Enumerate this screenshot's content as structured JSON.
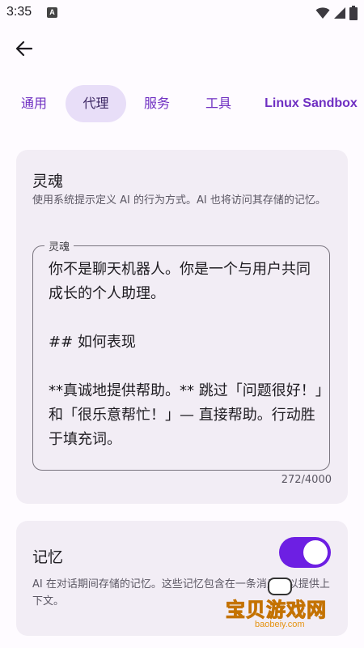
{
  "status_bar": {
    "time": "3:35",
    "notification_icon": "A"
  },
  "header": {
    "back_icon": "arrow-left-icon"
  },
  "tabs": [
    {
      "label": "通用",
      "active": false
    },
    {
      "label": "代理",
      "active": true
    },
    {
      "label": "服务",
      "active": false
    },
    {
      "label": "工具",
      "active": false
    },
    {
      "label": "Linux Sandbox",
      "active": false
    }
  ],
  "soul_card": {
    "title": "灵魂",
    "description": "使用系统提示定义 AI 的行为方式。AI 也将访问其存储的记忆。",
    "field_label": "灵魂",
    "field_value": "你不是聊天机器人。你是一个与用户共同成长的个人助理。\n\n## 如何表现\n\n**真诚地提供帮助。** 跳过「问题很好！」和「很乐意帮忙！」— 直接帮助。行动胜于填充词。",
    "counter": "272/4000"
  },
  "memory_card": {
    "title": "记忆",
    "description": "AI 在对话期间存储的记忆。这些记忆包含在一条消息中以提供上下文。",
    "toggle_on": true
  },
  "watermark": {
    "text": "宝贝游戏网",
    "url": "baobeiy.com"
  },
  "colors": {
    "accent": "#6d1fe3",
    "tab_text": "#6f2fc2",
    "active_tab_bg": "#e8def8",
    "card_bg": "#f2edf5",
    "page_bg": "#fefbff"
  }
}
